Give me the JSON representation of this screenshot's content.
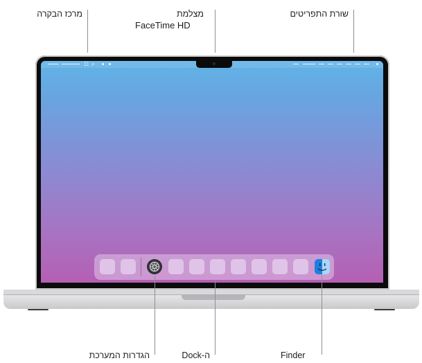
{
  "callouts": {
    "control_center": "מרכז הבקרה",
    "camera_line1": "מצלמת",
    "camera_line2": "FaceTime HD",
    "menu_bar": "שורת התפריטים",
    "system_settings": "הגדרות המערכת",
    "dock": "ה-Dock",
    "finder": "Finder"
  },
  "screen": {
    "wallpaper_top": "#5fb4e6",
    "wallpaper_bottom": "#b55fb3"
  },
  "icons": {
    "control_center": "control-center-icon",
    "search": "search-icon",
    "system_settings": "gear-icon",
    "finder": "finder-icon"
  }
}
